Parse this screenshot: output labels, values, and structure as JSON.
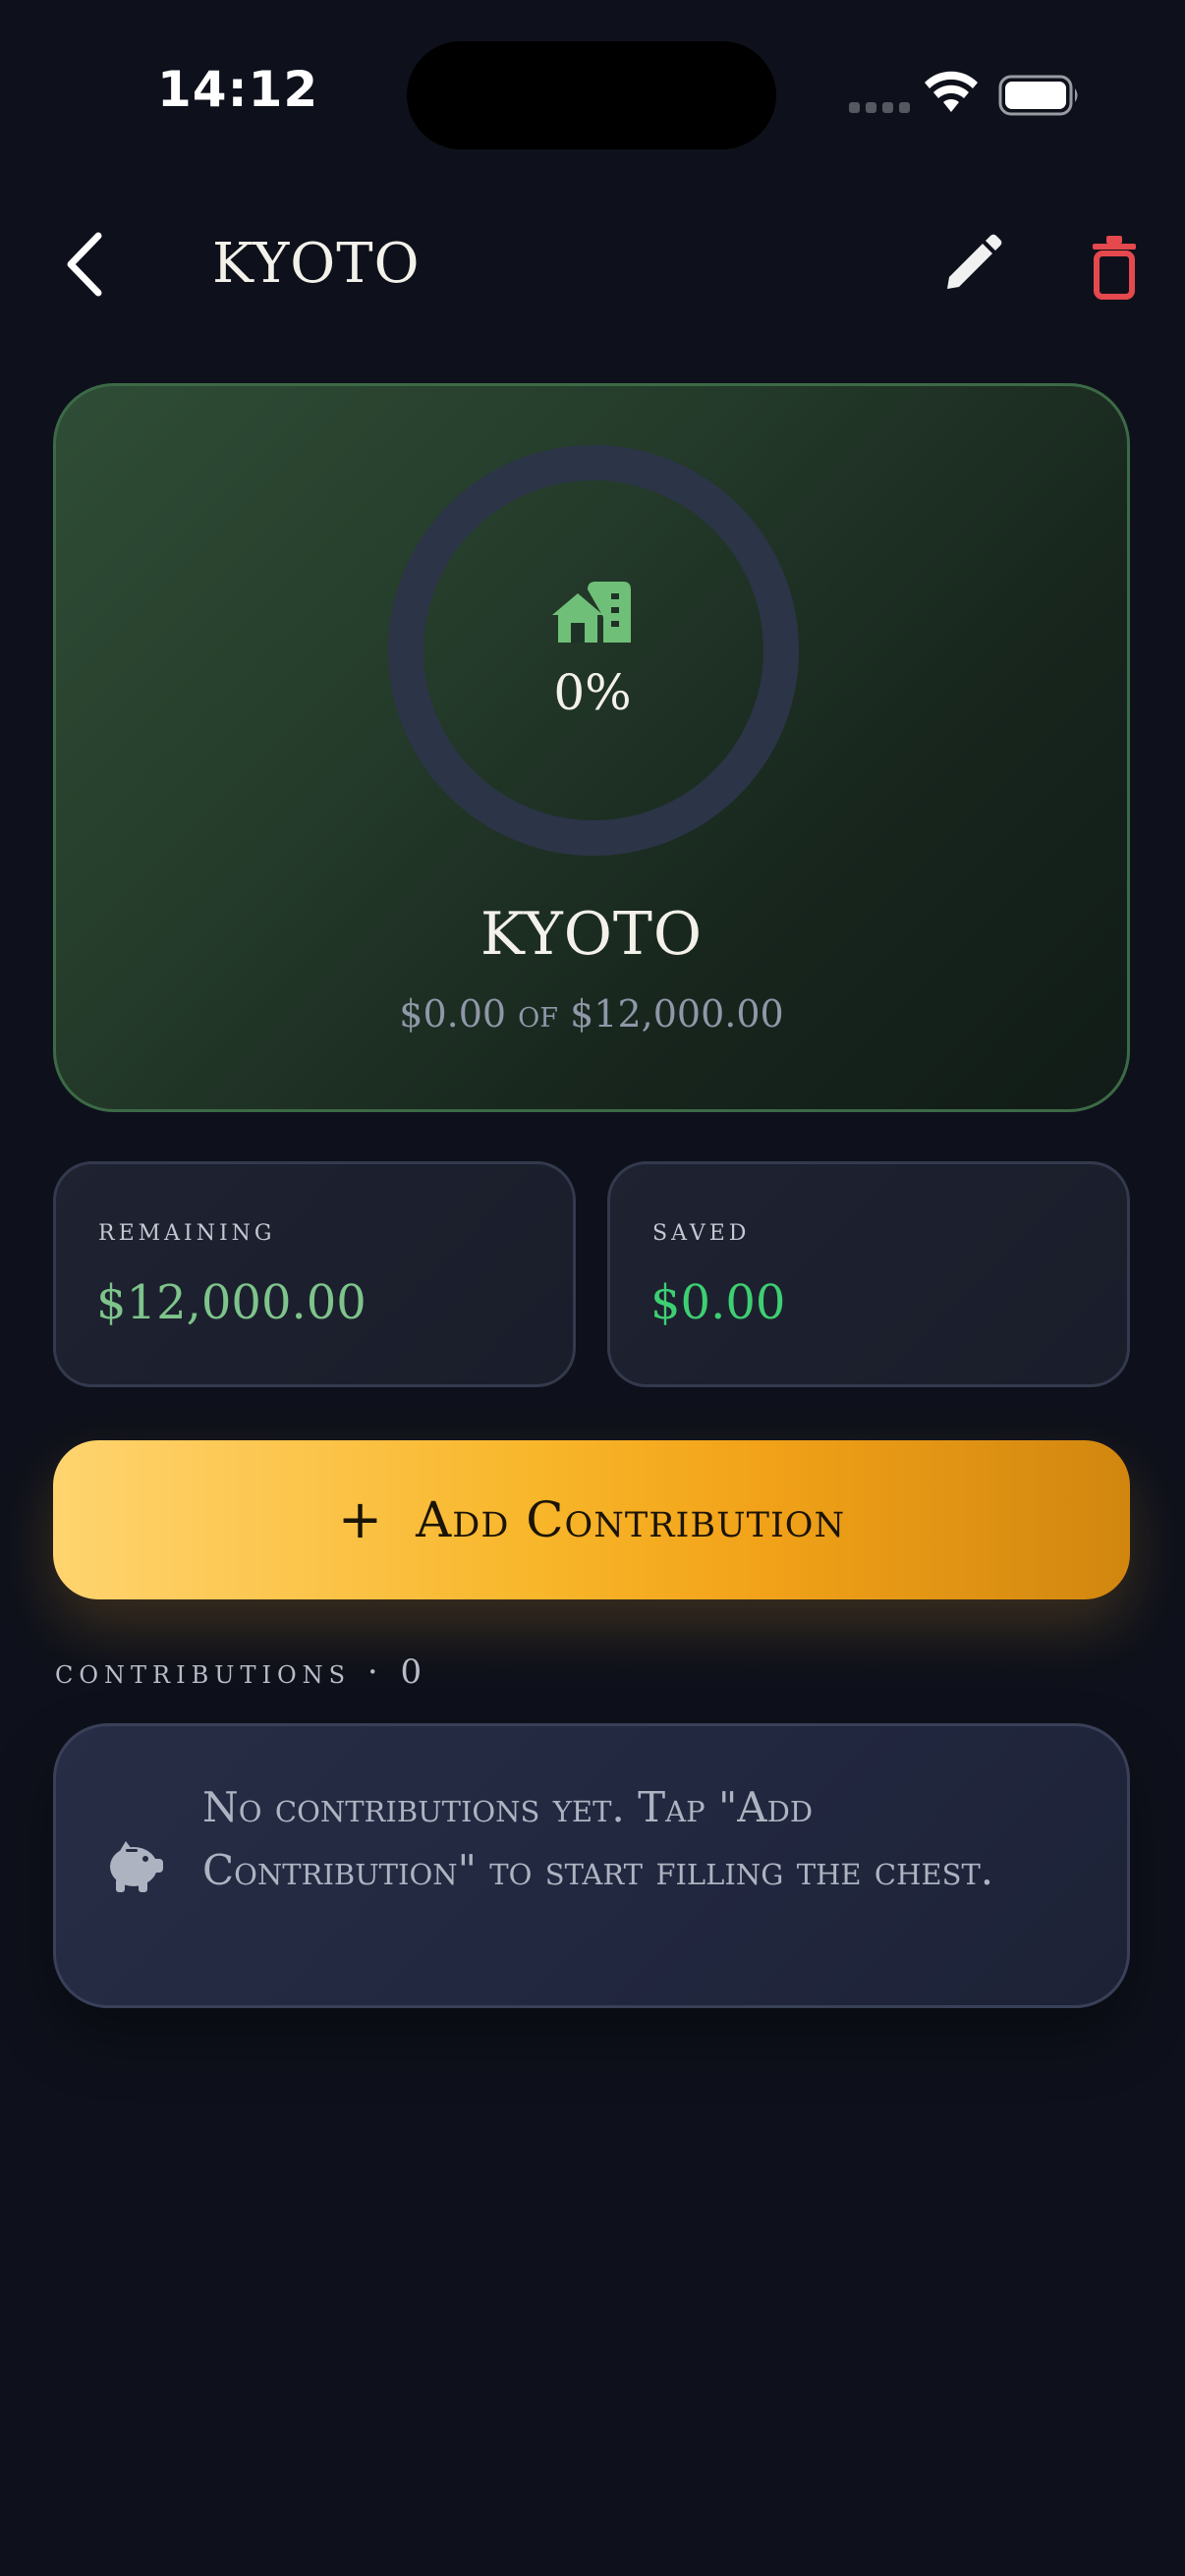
{
  "status_bar": {
    "time": "14:12"
  },
  "header": {
    "title": "KYOTO"
  },
  "goal": {
    "name": "KYOTO",
    "percent_label": "0%",
    "progress": 0,
    "amount_text": "$0.00 of $12,000.00",
    "icon": "home-building-icon"
  },
  "stats": {
    "remaining": {
      "label": "remaining",
      "value": "$12,000.00",
      "color": "#7ec48b"
    },
    "saved": {
      "label": "saved",
      "value": "$0.00",
      "color": "#3ecf72"
    }
  },
  "actions": {
    "add_plus": "+",
    "add_label": "Add Contribution"
  },
  "contributions": {
    "heading": "contributions · 0",
    "empty_text": "No contributions yet. Tap \"Add Contribution\" to start filling the chest.",
    "icon": "piggy-bank-icon"
  },
  "colors": {
    "background": "#0e111b",
    "accent_green": "#6fbf78",
    "danger_red": "#e5484d",
    "gold": "#f8b62a"
  }
}
